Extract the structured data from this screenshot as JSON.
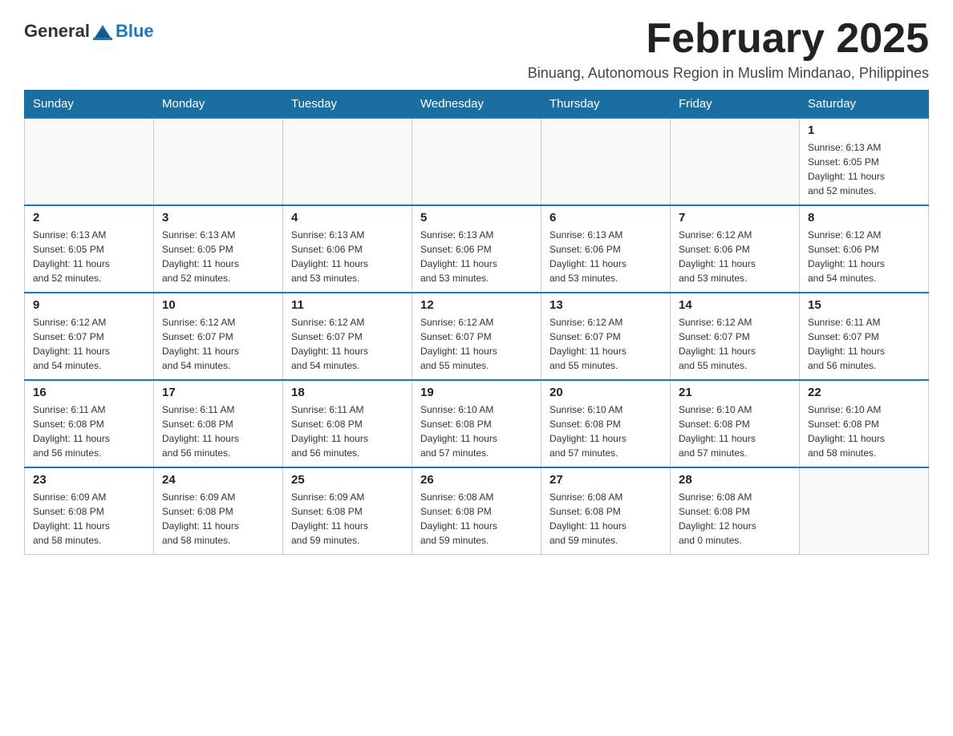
{
  "header": {
    "logo": {
      "general": "General",
      "blue": "Blue"
    },
    "title": "February 2025",
    "subtitle": "Binuang, Autonomous Region in Muslim Mindanao, Philippines"
  },
  "calendar": {
    "headers": [
      "Sunday",
      "Monday",
      "Tuesday",
      "Wednesday",
      "Thursday",
      "Friday",
      "Saturday"
    ],
    "weeks": [
      {
        "days": [
          {
            "number": "",
            "info": ""
          },
          {
            "number": "",
            "info": ""
          },
          {
            "number": "",
            "info": ""
          },
          {
            "number": "",
            "info": ""
          },
          {
            "number": "",
            "info": ""
          },
          {
            "number": "",
            "info": ""
          },
          {
            "number": "1",
            "info": "Sunrise: 6:13 AM\nSunset: 6:05 PM\nDaylight: 11 hours\nand 52 minutes."
          }
        ]
      },
      {
        "days": [
          {
            "number": "2",
            "info": "Sunrise: 6:13 AM\nSunset: 6:05 PM\nDaylight: 11 hours\nand 52 minutes."
          },
          {
            "number": "3",
            "info": "Sunrise: 6:13 AM\nSunset: 6:05 PM\nDaylight: 11 hours\nand 52 minutes."
          },
          {
            "number": "4",
            "info": "Sunrise: 6:13 AM\nSunset: 6:06 PM\nDaylight: 11 hours\nand 53 minutes."
          },
          {
            "number": "5",
            "info": "Sunrise: 6:13 AM\nSunset: 6:06 PM\nDaylight: 11 hours\nand 53 minutes."
          },
          {
            "number": "6",
            "info": "Sunrise: 6:13 AM\nSunset: 6:06 PM\nDaylight: 11 hours\nand 53 minutes."
          },
          {
            "number": "7",
            "info": "Sunrise: 6:12 AM\nSunset: 6:06 PM\nDaylight: 11 hours\nand 53 minutes."
          },
          {
            "number": "8",
            "info": "Sunrise: 6:12 AM\nSunset: 6:06 PM\nDaylight: 11 hours\nand 54 minutes."
          }
        ]
      },
      {
        "days": [
          {
            "number": "9",
            "info": "Sunrise: 6:12 AM\nSunset: 6:07 PM\nDaylight: 11 hours\nand 54 minutes."
          },
          {
            "number": "10",
            "info": "Sunrise: 6:12 AM\nSunset: 6:07 PM\nDaylight: 11 hours\nand 54 minutes."
          },
          {
            "number": "11",
            "info": "Sunrise: 6:12 AM\nSunset: 6:07 PM\nDaylight: 11 hours\nand 54 minutes."
          },
          {
            "number": "12",
            "info": "Sunrise: 6:12 AM\nSunset: 6:07 PM\nDaylight: 11 hours\nand 55 minutes."
          },
          {
            "number": "13",
            "info": "Sunrise: 6:12 AM\nSunset: 6:07 PM\nDaylight: 11 hours\nand 55 minutes."
          },
          {
            "number": "14",
            "info": "Sunrise: 6:12 AM\nSunset: 6:07 PM\nDaylight: 11 hours\nand 55 minutes."
          },
          {
            "number": "15",
            "info": "Sunrise: 6:11 AM\nSunset: 6:07 PM\nDaylight: 11 hours\nand 56 minutes."
          }
        ]
      },
      {
        "days": [
          {
            "number": "16",
            "info": "Sunrise: 6:11 AM\nSunset: 6:08 PM\nDaylight: 11 hours\nand 56 minutes."
          },
          {
            "number": "17",
            "info": "Sunrise: 6:11 AM\nSunset: 6:08 PM\nDaylight: 11 hours\nand 56 minutes."
          },
          {
            "number": "18",
            "info": "Sunrise: 6:11 AM\nSunset: 6:08 PM\nDaylight: 11 hours\nand 56 minutes."
          },
          {
            "number": "19",
            "info": "Sunrise: 6:10 AM\nSunset: 6:08 PM\nDaylight: 11 hours\nand 57 minutes."
          },
          {
            "number": "20",
            "info": "Sunrise: 6:10 AM\nSunset: 6:08 PM\nDaylight: 11 hours\nand 57 minutes."
          },
          {
            "number": "21",
            "info": "Sunrise: 6:10 AM\nSunset: 6:08 PM\nDaylight: 11 hours\nand 57 minutes."
          },
          {
            "number": "22",
            "info": "Sunrise: 6:10 AM\nSunset: 6:08 PM\nDaylight: 11 hours\nand 58 minutes."
          }
        ]
      },
      {
        "days": [
          {
            "number": "23",
            "info": "Sunrise: 6:09 AM\nSunset: 6:08 PM\nDaylight: 11 hours\nand 58 minutes."
          },
          {
            "number": "24",
            "info": "Sunrise: 6:09 AM\nSunset: 6:08 PM\nDaylight: 11 hours\nand 58 minutes."
          },
          {
            "number": "25",
            "info": "Sunrise: 6:09 AM\nSunset: 6:08 PM\nDaylight: 11 hours\nand 59 minutes."
          },
          {
            "number": "26",
            "info": "Sunrise: 6:08 AM\nSunset: 6:08 PM\nDaylight: 11 hours\nand 59 minutes."
          },
          {
            "number": "27",
            "info": "Sunrise: 6:08 AM\nSunset: 6:08 PM\nDaylight: 11 hours\nand 59 minutes."
          },
          {
            "number": "28",
            "info": "Sunrise: 6:08 AM\nSunset: 6:08 PM\nDaylight: 12 hours\nand 0 minutes."
          },
          {
            "number": "",
            "info": ""
          }
        ]
      }
    ]
  }
}
